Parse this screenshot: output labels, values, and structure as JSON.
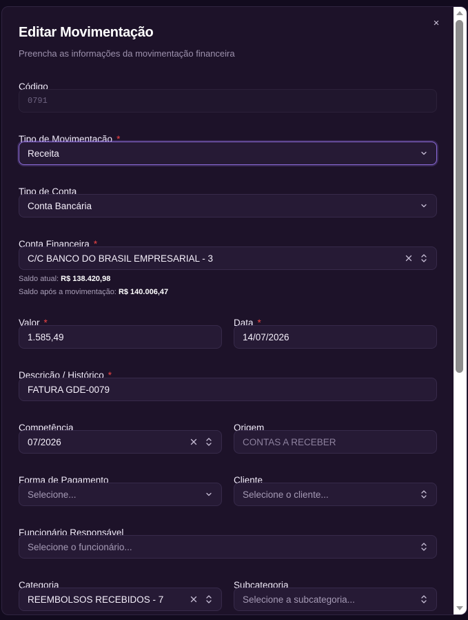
{
  "modal": {
    "title": "Editar Movimentação",
    "subtitle": "Preencha as informações da movimentação financeira",
    "close_icon": "×"
  },
  "fields": {
    "codigo": {
      "label": "Código",
      "value": "0791"
    },
    "tipo_movimentacao": {
      "label": "Tipo de Movimentação",
      "required": "*",
      "value": "Receita"
    },
    "tipo_conta": {
      "label": "Tipo de Conta",
      "value": "Conta Bancária"
    },
    "conta_financeira": {
      "label": "Conta Financeira",
      "required": "*",
      "value": "C/C BANCO DO BRASIL EMPRESARIAL - 3",
      "saldo_atual_label": "Saldo atual:",
      "saldo_atual": "R$ 138.420,98",
      "saldo_apos_label": "Saldo após a movimentação:",
      "saldo_apos": "R$ 140.006,47"
    },
    "valor": {
      "label": "Valor",
      "required": "*",
      "value": "1.585,49"
    },
    "data": {
      "label": "Data",
      "required": "*",
      "value": "14/07/2026"
    },
    "descricao": {
      "label": "Descrição / Histórico",
      "required": "*",
      "value": "FATURA GDE-0079"
    },
    "competencia": {
      "label": "Competência",
      "value": "07/2026"
    },
    "origem": {
      "label": "Origem",
      "value": "CONTAS A RECEBER"
    },
    "forma_pagamento": {
      "label": "Forma de Pagamento",
      "placeholder": "Selecione..."
    },
    "cliente": {
      "label": "Cliente",
      "placeholder": "Selecione o cliente..."
    },
    "funcionario": {
      "label": "Funcionário Responsável",
      "placeholder": "Selecione o funcionário..."
    },
    "categoria": {
      "label": "Categoria",
      "value": "REEMBOLSOS RECEBIDOS - 7"
    },
    "subcategoria": {
      "label": "Subcategoria",
      "placeholder": "Selecione a subcategoria..."
    }
  },
  "colors": {
    "background": "#1d1229",
    "field": "#261a35",
    "focus_border": "#8b6ad8",
    "required": "#ef4444"
  }
}
